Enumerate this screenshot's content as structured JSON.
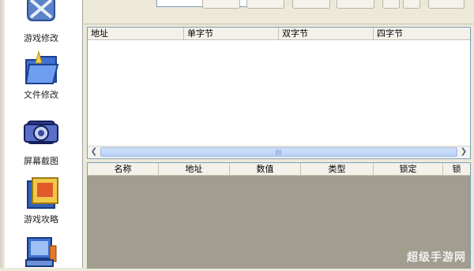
{
  "sidebar": {
    "items": [
      {
        "label": "游戏修改",
        "icon": "tools-x-icon"
      },
      {
        "label": "文件修改",
        "icon": "folder-icon"
      },
      {
        "label": "屏幕截图",
        "icon": "camera-icon"
      },
      {
        "label": "游戏攻略",
        "icon": "secret-book-icon"
      },
      {
        "label": "",
        "icon": "computer-icon"
      }
    ]
  },
  "address_table": {
    "columns": [
      "地址",
      "单字节",
      "双字节",
      "四字节"
    ],
    "rows": []
  },
  "list_table": {
    "columns": [
      "名称",
      "地址",
      "数值",
      "类型",
      "锁定",
      "锁"
    ],
    "rows": []
  },
  "watermark": "超级手游网",
  "colors": {
    "scroll_thumb": "#b9d1f7",
    "empty_area": "#a19d8f",
    "window_bg": "#ece9d8"
  }
}
